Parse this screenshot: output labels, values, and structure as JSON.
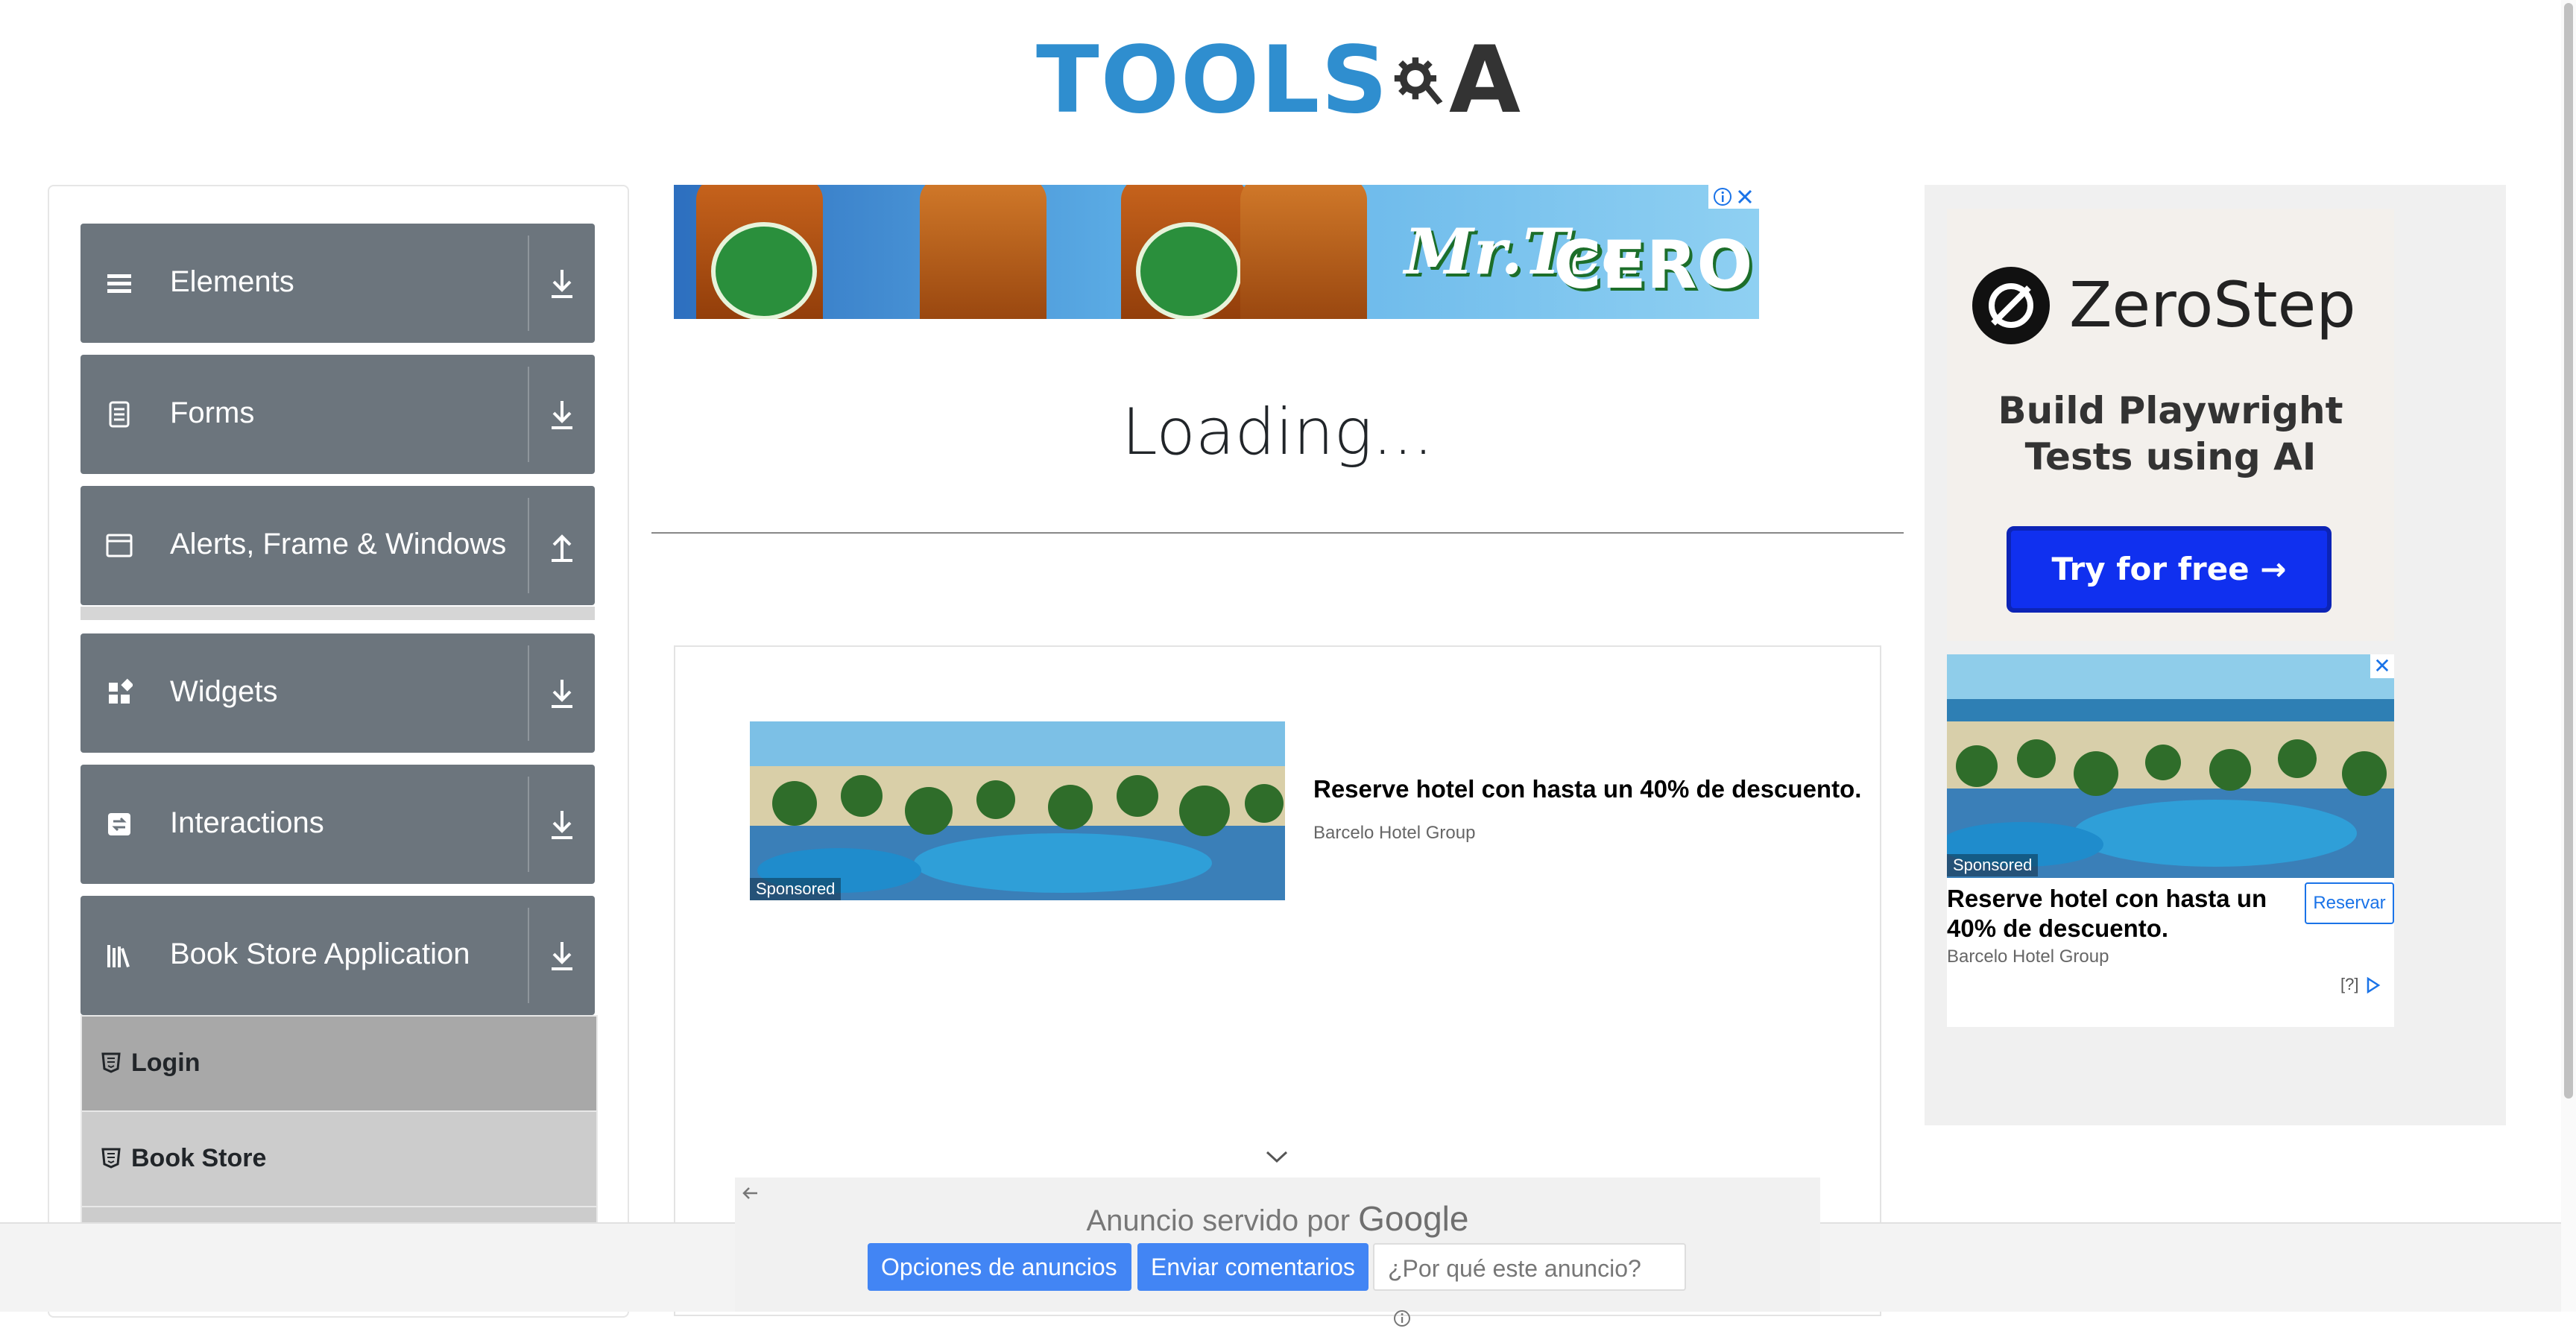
{
  "header": {
    "logo_text_left": "TOOLS",
    "logo_text_right": "A"
  },
  "sidebar": {
    "groups": [
      {
        "label": "Elements",
        "icon": "menu-lines-icon",
        "arrow": "download-icon"
      },
      {
        "label": "Forms",
        "icon": "document-icon",
        "arrow": "download-icon"
      },
      {
        "label": "Alerts, Frame & Windows",
        "icon": "window-icon",
        "arrow": "upload-icon"
      },
      {
        "label": "Widgets",
        "icon": "widgets-icon",
        "arrow": "download-icon"
      },
      {
        "label": "Interactions",
        "icon": "interactions-icon",
        "arrow": "download-icon"
      },
      {
        "label": "Book Store Application",
        "icon": "books-icon",
        "arrow": "download-icon"
      }
    ],
    "subitems": [
      {
        "label": "Login",
        "icon": "html5-icon",
        "active": true
      },
      {
        "label": "Book Store",
        "icon": "html5-icon",
        "active": false
      }
    ]
  },
  "main": {
    "loading_text": "Loading..."
  },
  "banner_ad": {
    "brand": "Mr.Tea",
    "product": "CERO",
    "info_icon": "info-icon",
    "close_icon": "close-icon"
  },
  "mid_ad": {
    "sponsored": "Sponsored",
    "headline": "Reserve hotel con hasta un 40% de descuento.",
    "advertiser": "Barcelo Hotel Group"
  },
  "google_bar": {
    "served_by": "Anuncio servido por",
    "google": "Google",
    "btn_options": "Opciones de anuncios",
    "btn_feedback": "Enviar comentarios",
    "btn_why": "¿Por qué este anuncio?"
  },
  "right_ad": {
    "brand": "ZeroStep",
    "tagline_1": "Build Playwright",
    "tagline_2": "Tests using AI",
    "cta": "Try for free →",
    "sponsored": "Sponsored",
    "headline": "Reserve hotel con hasta un 40% de descuento.",
    "advertiser": "Barcelo Hotel Group",
    "button": "Reservar",
    "adchoice": "[?]"
  },
  "colors": {
    "sidebar_group_bg": "#6c757d",
    "logo_blue": "#2f8ecf",
    "google_blue": "#4285f4",
    "zerostep_blue": "#1030ef"
  }
}
